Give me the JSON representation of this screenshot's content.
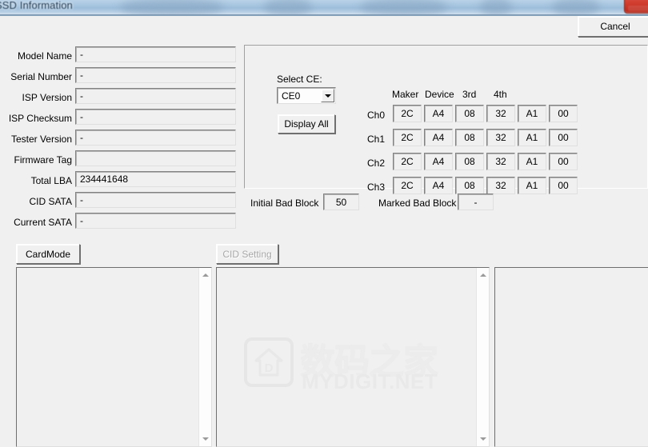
{
  "window": {
    "title": "SSD Information",
    "close_icon": "close-icon"
  },
  "toolbar": {
    "cancel_label": "Cancel"
  },
  "info_fields": [
    {
      "label": "Model Name",
      "value": "-"
    },
    {
      "label": "Serial Number",
      "value": "-"
    },
    {
      "label": "ISP Version",
      "value": "-"
    },
    {
      "label": "ISP Checksum",
      "value": "-"
    },
    {
      "label": "Tester Version",
      "value": "-"
    },
    {
      "label": "Firmware Tag",
      "value": ""
    },
    {
      "label": "Total LBA",
      "value": "234441648"
    },
    {
      "label": "CID SATA",
      "value": "-"
    },
    {
      "label": "Current SATA",
      "value": "-"
    }
  ],
  "ce_panel": {
    "select_ce_label": "Select CE:",
    "selected_ce": "CE0",
    "ce_options": [
      "CE0"
    ],
    "display_all_label": "Display All",
    "dropdown_icon": "chevron-down-icon",
    "column_headers": [
      "Maker",
      "Device",
      "3rd",
      "4th"
    ],
    "rows": [
      {
        "channel": "Ch0",
        "cells": [
          "2C",
          "A4",
          "08",
          "32",
          "A1",
          "00"
        ]
      },
      {
        "channel": "Ch1",
        "cells": [
          "2C",
          "A4",
          "08",
          "32",
          "A1",
          "00"
        ]
      },
      {
        "channel": "Ch2",
        "cells": [
          "2C",
          "A4",
          "08",
          "32",
          "A1",
          "00"
        ]
      },
      {
        "channel": "Ch3",
        "cells": [
          "2C",
          "A4",
          "08",
          "32",
          "A1",
          "00"
        ]
      }
    ]
  },
  "bad_block": {
    "initial_label": "Initial Bad Block",
    "initial_value": "50",
    "marked_label": "Marked Bad Block",
    "marked_value": "-"
  },
  "actions": {
    "card_mode_label": "CardMode",
    "cid_setting_label": "CID Setting"
  },
  "watermark": {
    "cn_text": "数码之家",
    "en_text": "MYDIGIT.NET",
    "logo_icon": "mydigit-house-logo-icon"
  }
}
